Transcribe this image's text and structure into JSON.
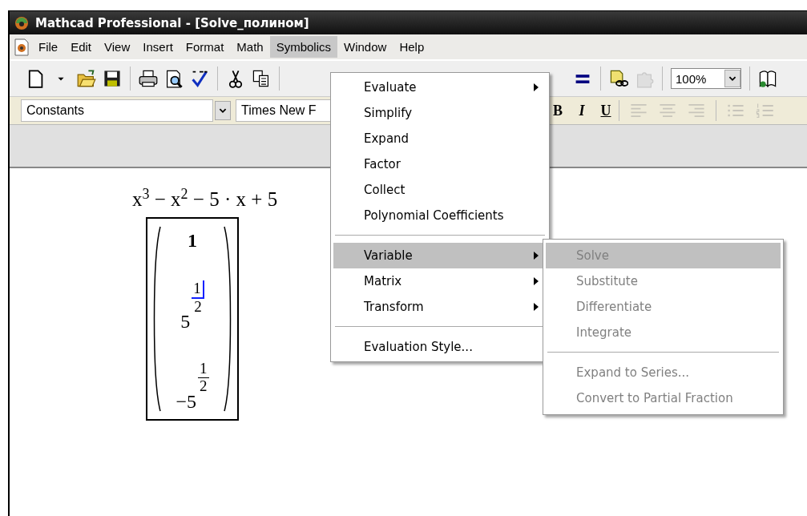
{
  "window": {
    "title": "Mathcad Professional - [Solve_полином]"
  },
  "menu_bar": [
    {
      "label": "File",
      "selected": false
    },
    {
      "label": "Edit",
      "selected": false
    },
    {
      "label": "View",
      "selected": false
    },
    {
      "label": "Insert",
      "selected": false
    },
    {
      "label": "Format",
      "selected": false
    },
    {
      "label": "Math",
      "selected": false
    },
    {
      "label": "Symbolics",
      "selected": true
    },
    {
      "label": "Window",
      "selected": false
    },
    {
      "label": "Help",
      "selected": false
    }
  ],
  "toolbar": {
    "left_groups": [
      [
        {
          "kind": "new",
          "disabled": false
        },
        {
          "kind": "dropdown",
          "disabled": false
        },
        {
          "kind": "open",
          "disabled": false
        },
        {
          "kind": "save",
          "disabled": false
        }
      ],
      [
        {
          "kind": "print",
          "disabled": false
        },
        {
          "kind": "preview",
          "disabled": false
        },
        {
          "kind": "spell",
          "disabled": false
        }
      ],
      [
        {
          "kind": "cut",
          "disabled": false
        },
        {
          "kind": "copy",
          "disabled": false
        }
      ]
    ],
    "right_groups": [
      [
        {
          "kind": "equals",
          "disabled": false
        }
      ],
      [
        {
          "kind": "link",
          "disabled": false
        },
        {
          "kind": "component",
          "disabled": true
        }
      ],
      [
        {
          "kind": "zoom",
          "value": "100%",
          "disabled": false
        }
      ],
      [
        {
          "kind": "book",
          "disabled": false
        }
      ]
    ]
  },
  "format_bar": {
    "style": "Constants",
    "font": "Times New F",
    "text_buttons": [
      {
        "label": "B"
      },
      {
        "label": "I"
      },
      {
        "label": "U"
      }
    ],
    "align_buttons": [
      {
        "kind": "left",
        "disabled": true
      },
      {
        "kind": "center",
        "disabled": true
      },
      {
        "kind": "right",
        "disabled": true
      }
    ],
    "list_buttons": [
      {
        "kind": "bullets",
        "disabled": true
      },
      {
        "kind": "numbers",
        "disabled": true
      }
    ]
  },
  "symbolics_menu": {
    "groups": [
      [
        {
          "label": "Evaluate",
          "submenu": true,
          "selected": false,
          "disabled": false
        },
        {
          "label": "Simplify",
          "submenu": false,
          "selected": false,
          "disabled": false
        },
        {
          "label": "Expand",
          "submenu": false,
          "selected": false,
          "disabled": false
        },
        {
          "label": "Factor",
          "submenu": false,
          "selected": false,
          "disabled": false
        },
        {
          "label": "Collect",
          "submenu": false,
          "selected": false,
          "disabled": false
        },
        {
          "label": "Polynomial Coefficients",
          "submenu": false,
          "selected": false,
          "disabled": false
        }
      ],
      [
        {
          "label": "Variable",
          "submenu": true,
          "selected": true,
          "disabled": false
        },
        {
          "label": "Matrix",
          "submenu": true,
          "selected": false,
          "disabled": false
        },
        {
          "label": "Transform",
          "submenu": true,
          "selected": false,
          "disabled": false
        }
      ],
      [
        {
          "label": "Evaluation Style...",
          "submenu": false,
          "selected": false,
          "disabled": false
        }
      ]
    ]
  },
  "variable_submenu": {
    "groups": [
      [
        {
          "label": "Solve",
          "submenu": false,
          "selected": true,
          "disabled": true
        },
        {
          "label": "Substitute",
          "submenu": false,
          "selected": false,
          "disabled": true
        },
        {
          "label": "Differentiate",
          "submenu": false,
          "selected": false,
          "disabled": true
        },
        {
          "label": "Integrate",
          "submenu": false,
          "selected": false,
          "disabled": true
        }
      ],
      [
        {
          "label": "Expand to Series...",
          "submenu": false,
          "selected": false,
          "disabled": true
        },
        {
          "label": "Convert to Partial Fraction",
          "submenu": false,
          "selected": false,
          "disabled": true
        }
      ]
    ]
  },
  "worksheet": {
    "expression": "x$^{3}$ − x$^{2}$ − 5 · x + 5",
    "result_matrix": [
      {
        "kind": "plain",
        "text": "1",
        "cursor": false
      },
      {
        "kind": "power",
        "base": "5",
        "numerator": "1",
        "denominator": "2",
        "cursor": true
      },
      {
        "kind": "power",
        "base": "−5",
        "numerator": "1",
        "denominator": "2",
        "cursor": false
      }
    ]
  }
}
